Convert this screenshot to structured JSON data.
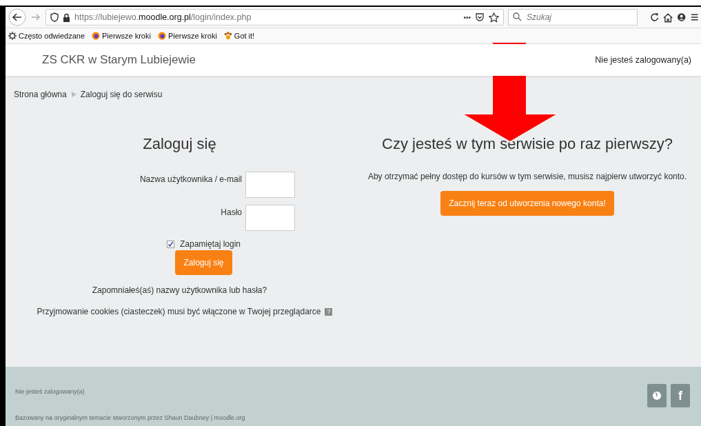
{
  "browser": {
    "url_prefix": "https://lubiejewo.",
    "url_domain": "moodle.org.pl",
    "url_path": "/login/index.php",
    "more": "•••",
    "search_placeholder": "Szukaj",
    "bookmarks": [
      {
        "label": "Często odwiedzane",
        "kind": "gear"
      },
      {
        "label": "Pierwsze kroki",
        "kind": "firefox"
      },
      {
        "label": "Pierwsze kroki",
        "kind": "firefox"
      },
      {
        "label": "Got it!",
        "kind": "paw"
      }
    ]
  },
  "header": {
    "site_name": "ZS CKR w Starym Lubiejewie",
    "login_status": "Nie jesteś zalogowany(a)"
  },
  "breadcrumb": [
    "Strona główna",
    "Zaloguj się do serwisu"
  ],
  "login": {
    "title": "Zaloguj się",
    "username_label": "Nazwa użytkownika / e-mail",
    "password_label": "Hasło",
    "remember": {
      "label": "Zapamiętaj login",
      "checked": true
    },
    "submit": "Zaloguj się",
    "forgot": "Zapomniałeś(aś) nazwy użytkownika lub hasła?",
    "cookies": "Przyjmowanie cookies (ciasteczek) musi być włączone w Twojej przeglądarce",
    "help": "?"
  },
  "signup": {
    "title": "Czy jesteś w tym serwisie po raz pierwszy?",
    "text": "Aby otrzymać pełny dostęp do kursów w tym serwisie, musisz najpierw utworzyć konto.",
    "button": "Zacznij teraz od utworzenia nowego konta!"
  },
  "footer": {
    "login_status": "Nie jesteś zalogowany(a)",
    "credits": "Bazowany na oryginalnym temacie stworzonym przez Shaun Daubney | moodle.org",
    "social": [
      {
        "kind": "globe"
      },
      {
        "kind": "facebook",
        "label": "f"
      }
    ]
  },
  "annotation": {
    "kind": "down-arrow",
    "color": "#ff0000"
  }
}
